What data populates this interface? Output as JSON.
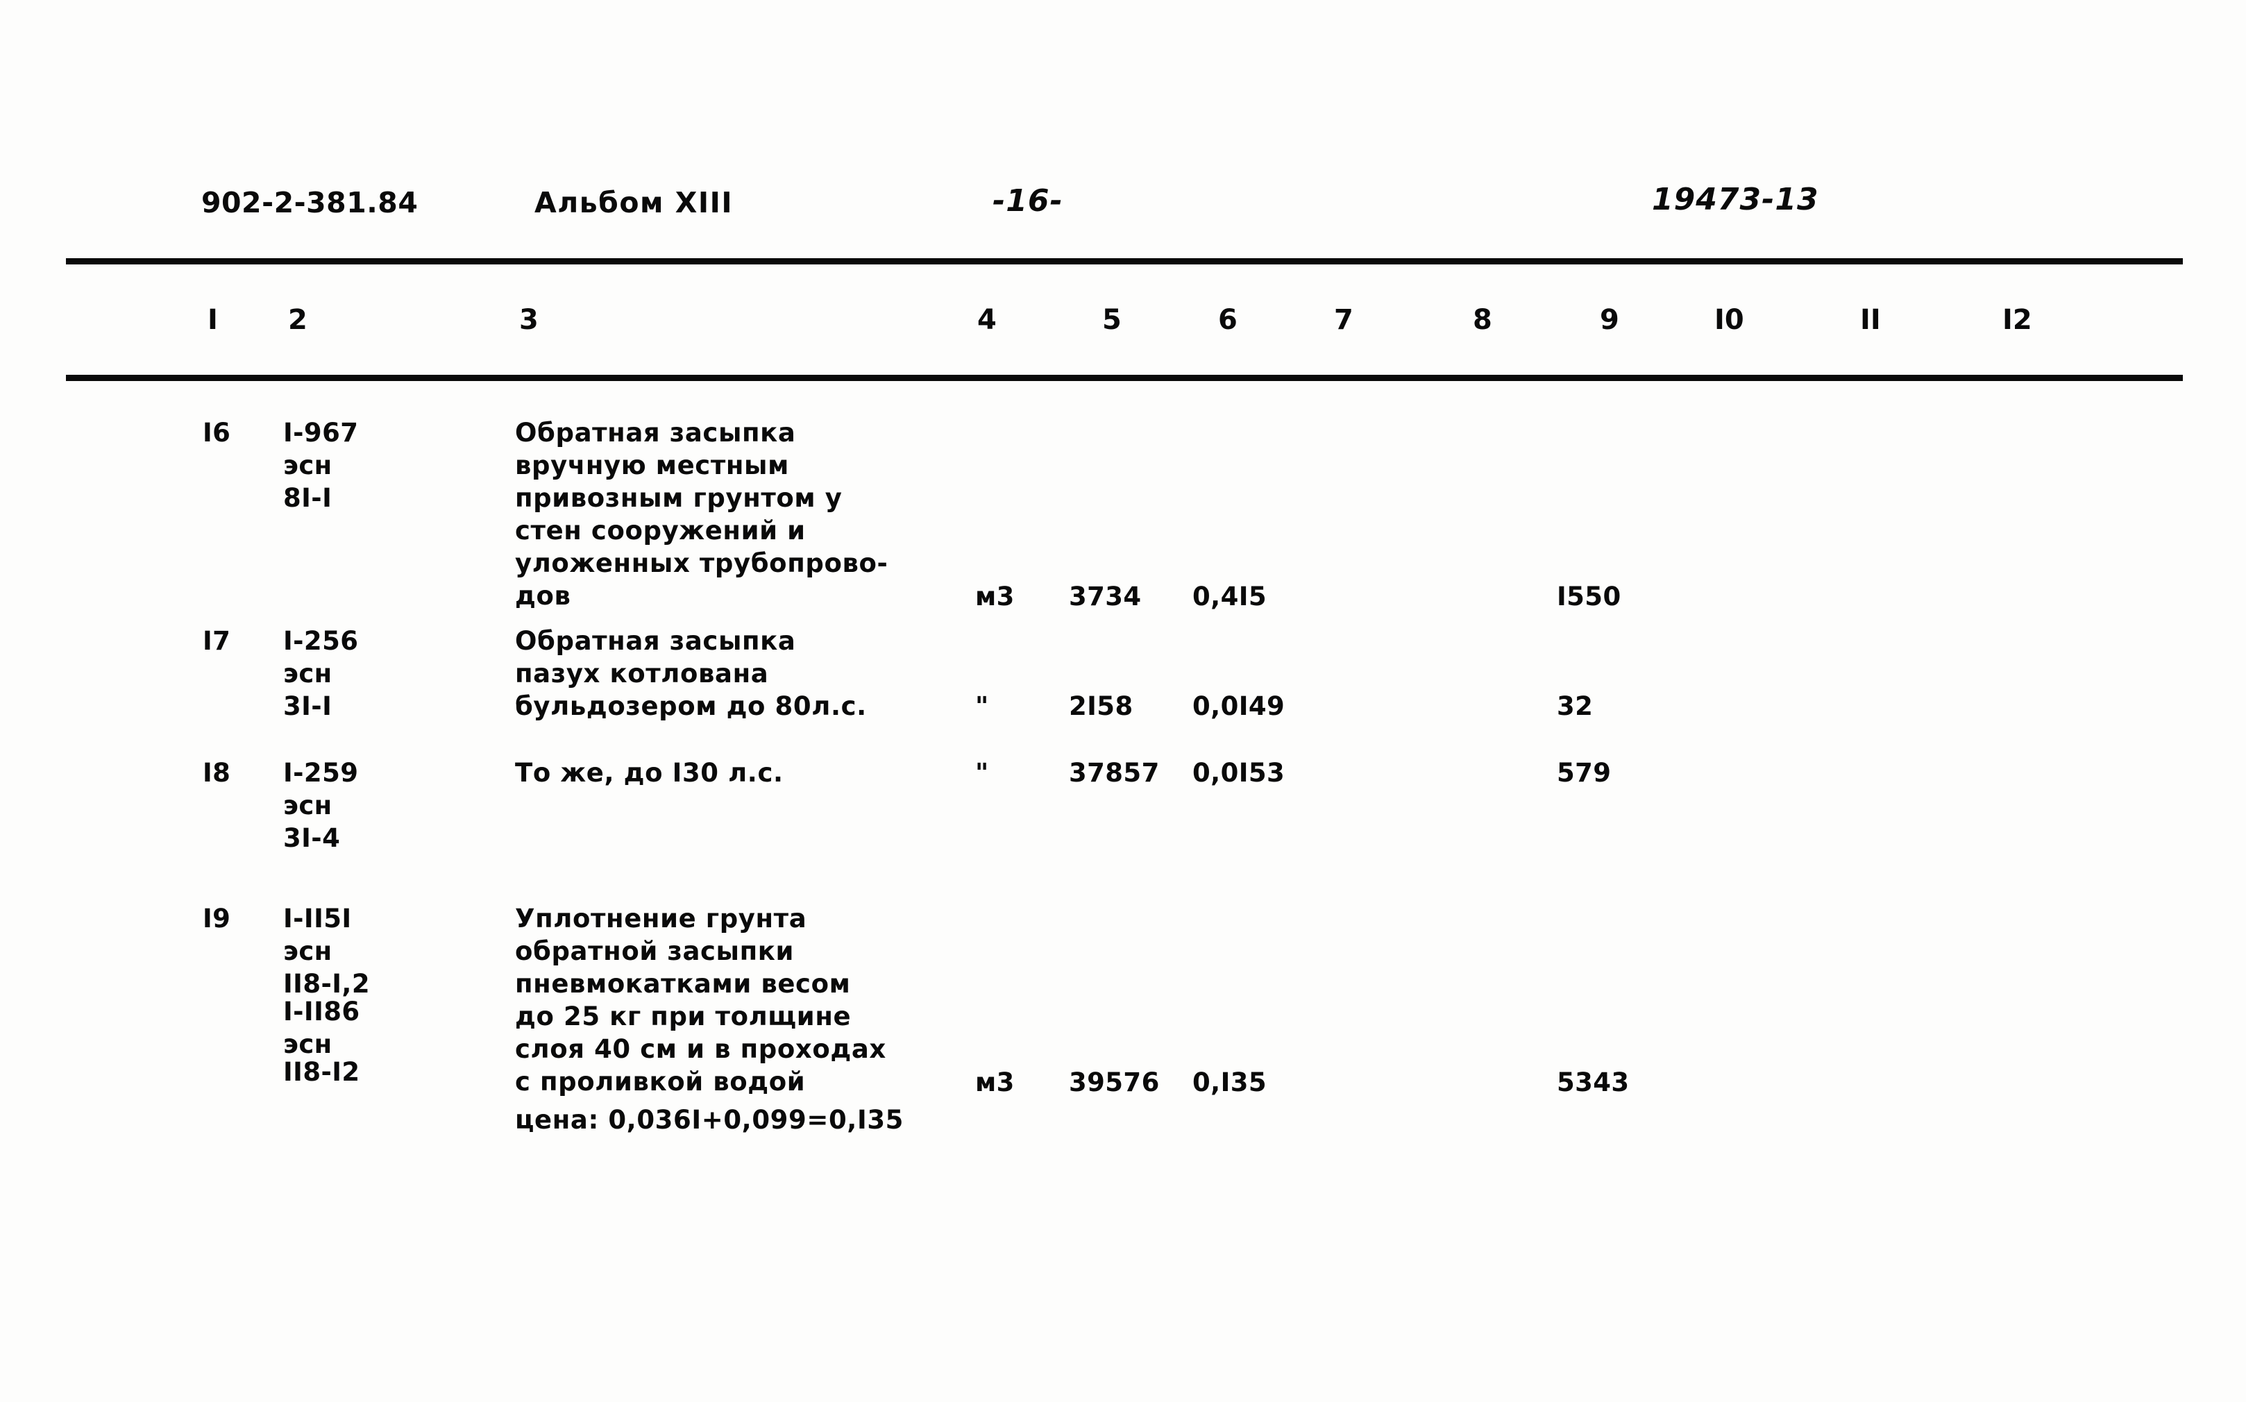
{
  "header": {
    "doc_code": "902-2-381.84",
    "album": "Альбом XIII",
    "page_number": "-16-",
    "archive_code": "19473-13"
  },
  "table": {
    "column_headers": [
      "I",
      "2",
      "3",
      "4",
      "5",
      "6",
      "7",
      "8",
      "9",
      "I0",
      "II",
      "I2"
    ],
    "rows": [
      {
        "num": "I6",
        "code": "I-967\nэсн\n8I-I",
        "description": "Обратная засыпка\nвручную местным\nпривозным грунтом у\nстен сооружений и\nуложенных трубопрово-\nдов",
        "unit": "м3",
        "col5": "3734",
        "col6": "0,4I5",
        "col7": "",
        "col8": "",
        "col9": "I550",
        "col10": "",
        "col11": "",
        "col12": ""
      },
      {
        "num": "I7",
        "code": "I-256\nэсн\n3I-I",
        "description": "Обратная засыпка\nпазух котлована\nбульдозером до 80л.с.",
        "unit": "\"",
        "col5": "2I58",
        "col6": "0,0I49",
        "col7": "",
        "col8": "",
        "col9": "32",
        "col10": "",
        "col11": "",
        "col12": ""
      },
      {
        "num": "I8",
        "code": "I-259\nэсн\n3I-4",
        "description": "То же, до I30 л.с.",
        "unit": "\"",
        "col5": "37857",
        "col6": "0,0I53",
        "col7": "",
        "col8": "",
        "col9": "579",
        "col10": "",
        "col11": "",
        "col12": ""
      },
      {
        "num": "I9",
        "code_line1": "I-II5I",
        "code_line2": "эсн",
        "code_line3": "II8-I,2",
        "code_line4": "I-II86",
        "code_line5": "эсн",
        "code_line6": "II8-I2",
        "description": "Уплотнение грунта\nобратной засыпки\nпневмокатками весом\nдо 25 кг при толщине\nслоя 40 см и в проходах\nс проливкой водой",
        "note": "цена: 0,036I+0,099=0,I35",
        "unit": "м3",
        "col5": "39576",
        "col6": "0,I35",
        "col7": "",
        "col8": "",
        "col9": "5343",
        "col10": "",
        "col11": "",
        "col12": ""
      }
    ]
  }
}
